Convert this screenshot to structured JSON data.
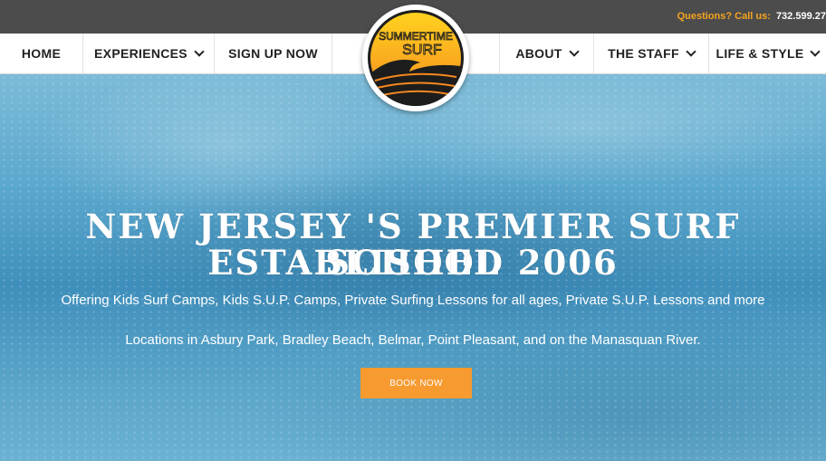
{
  "topbar": {
    "question": "Questions? Call us:",
    "phone": "732.599.27"
  },
  "nav": {
    "home": "HOME",
    "experiences": "EXPERIENCES",
    "signup": "SIGN UP NOW",
    "about": "ABOUT",
    "staff": "THE STAFF",
    "life": "LIFE & STYLE"
  },
  "logo": {
    "line1": "SUMMERTIME",
    "line2": "SURF"
  },
  "hero": {
    "headline1": "NEW JERSEY 'S PREMIER SURF SCHOOL",
    "headline2": "ESTABLISHED 2006",
    "subline1": "Offering Kids Surf Camps, Kids S.U.P. Camps, Private Surfing Lessons for all ages, Private S.U.P. Lessons and more",
    "subline2": "Locations in Asbury Park, Bradley Beach, Belmar, Point Pleasant, and on the Manasquan River.",
    "button": "BOOK NOW"
  },
  "colors": {
    "accent": "#f79a30",
    "topbar": "#4c4c4c",
    "phone_label": "#f6a41e"
  },
  "icons": [
    "chevron-down-icon",
    "summertime-surf-logo"
  ]
}
